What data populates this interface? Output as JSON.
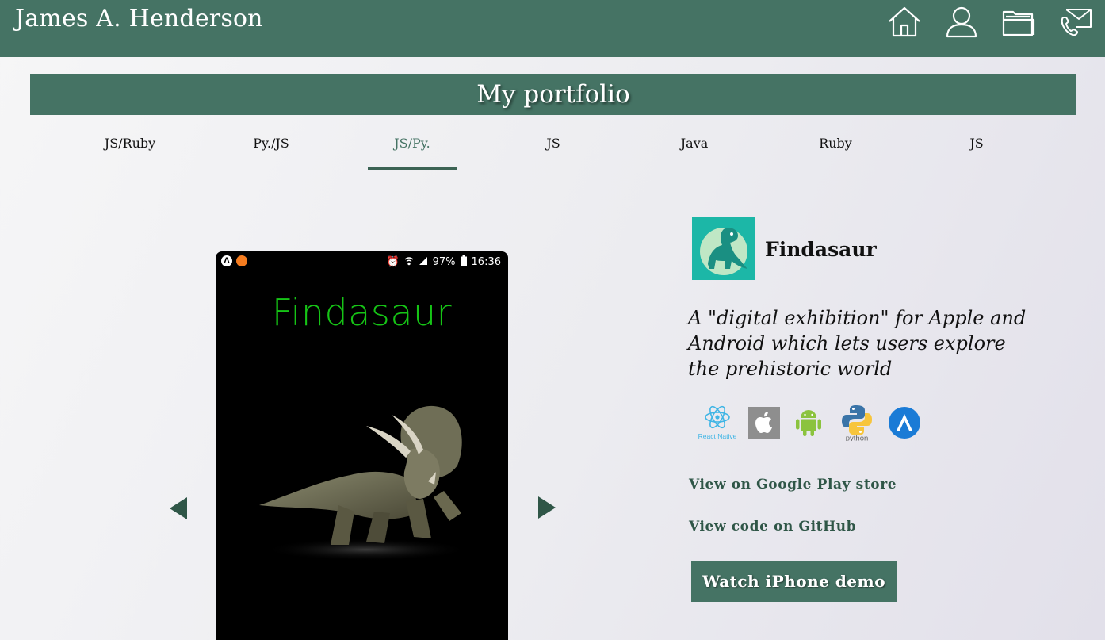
{
  "header": {
    "site_title": "James A. Henderson",
    "nav": [
      {
        "icon": "home-icon"
      },
      {
        "icon": "user-icon"
      },
      {
        "icon": "folder-icon"
      },
      {
        "icon": "envelope-phone-icon"
      }
    ]
  },
  "portfolio": {
    "title": "My portfolio",
    "tabs": [
      {
        "label": "JS/Ruby"
      },
      {
        "label": "Py./JS"
      },
      {
        "label": "JS/Py.",
        "active": true
      },
      {
        "label": "JS"
      },
      {
        "label": "Java"
      },
      {
        "label": "Ruby"
      },
      {
        "label": "JS"
      }
    ]
  },
  "phone": {
    "battery": "97%",
    "time": "16:36",
    "app_name": "Findasaur"
  },
  "project": {
    "title": "Findasaur",
    "description": "A \"digital exhibition\" for Apple and Android which lets users explore the prehistoric world",
    "tech": [
      {
        "name": "React Native",
        "icon": "react-icon"
      },
      {
        "name": "Apple",
        "icon": "apple-icon"
      },
      {
        "name": "Android",
        "icon": "android-icon"
      },
      {
        "name": "python",
        "icon": "python-icon"
      },
      {
        "name": "Expo",
        "icon": "expo-icon"
      }
    ],
    "links": {
      "play_store": "View on Google Play store",
      "github": "View code on GitHub"
    },
    "demo_button": "Watch iPhone demo"
  },
  "colors": {
    "primary": "#457364",
    "phone_title": "#16c416",
    "logo_bg": "#1cb7a7"
  }
}
